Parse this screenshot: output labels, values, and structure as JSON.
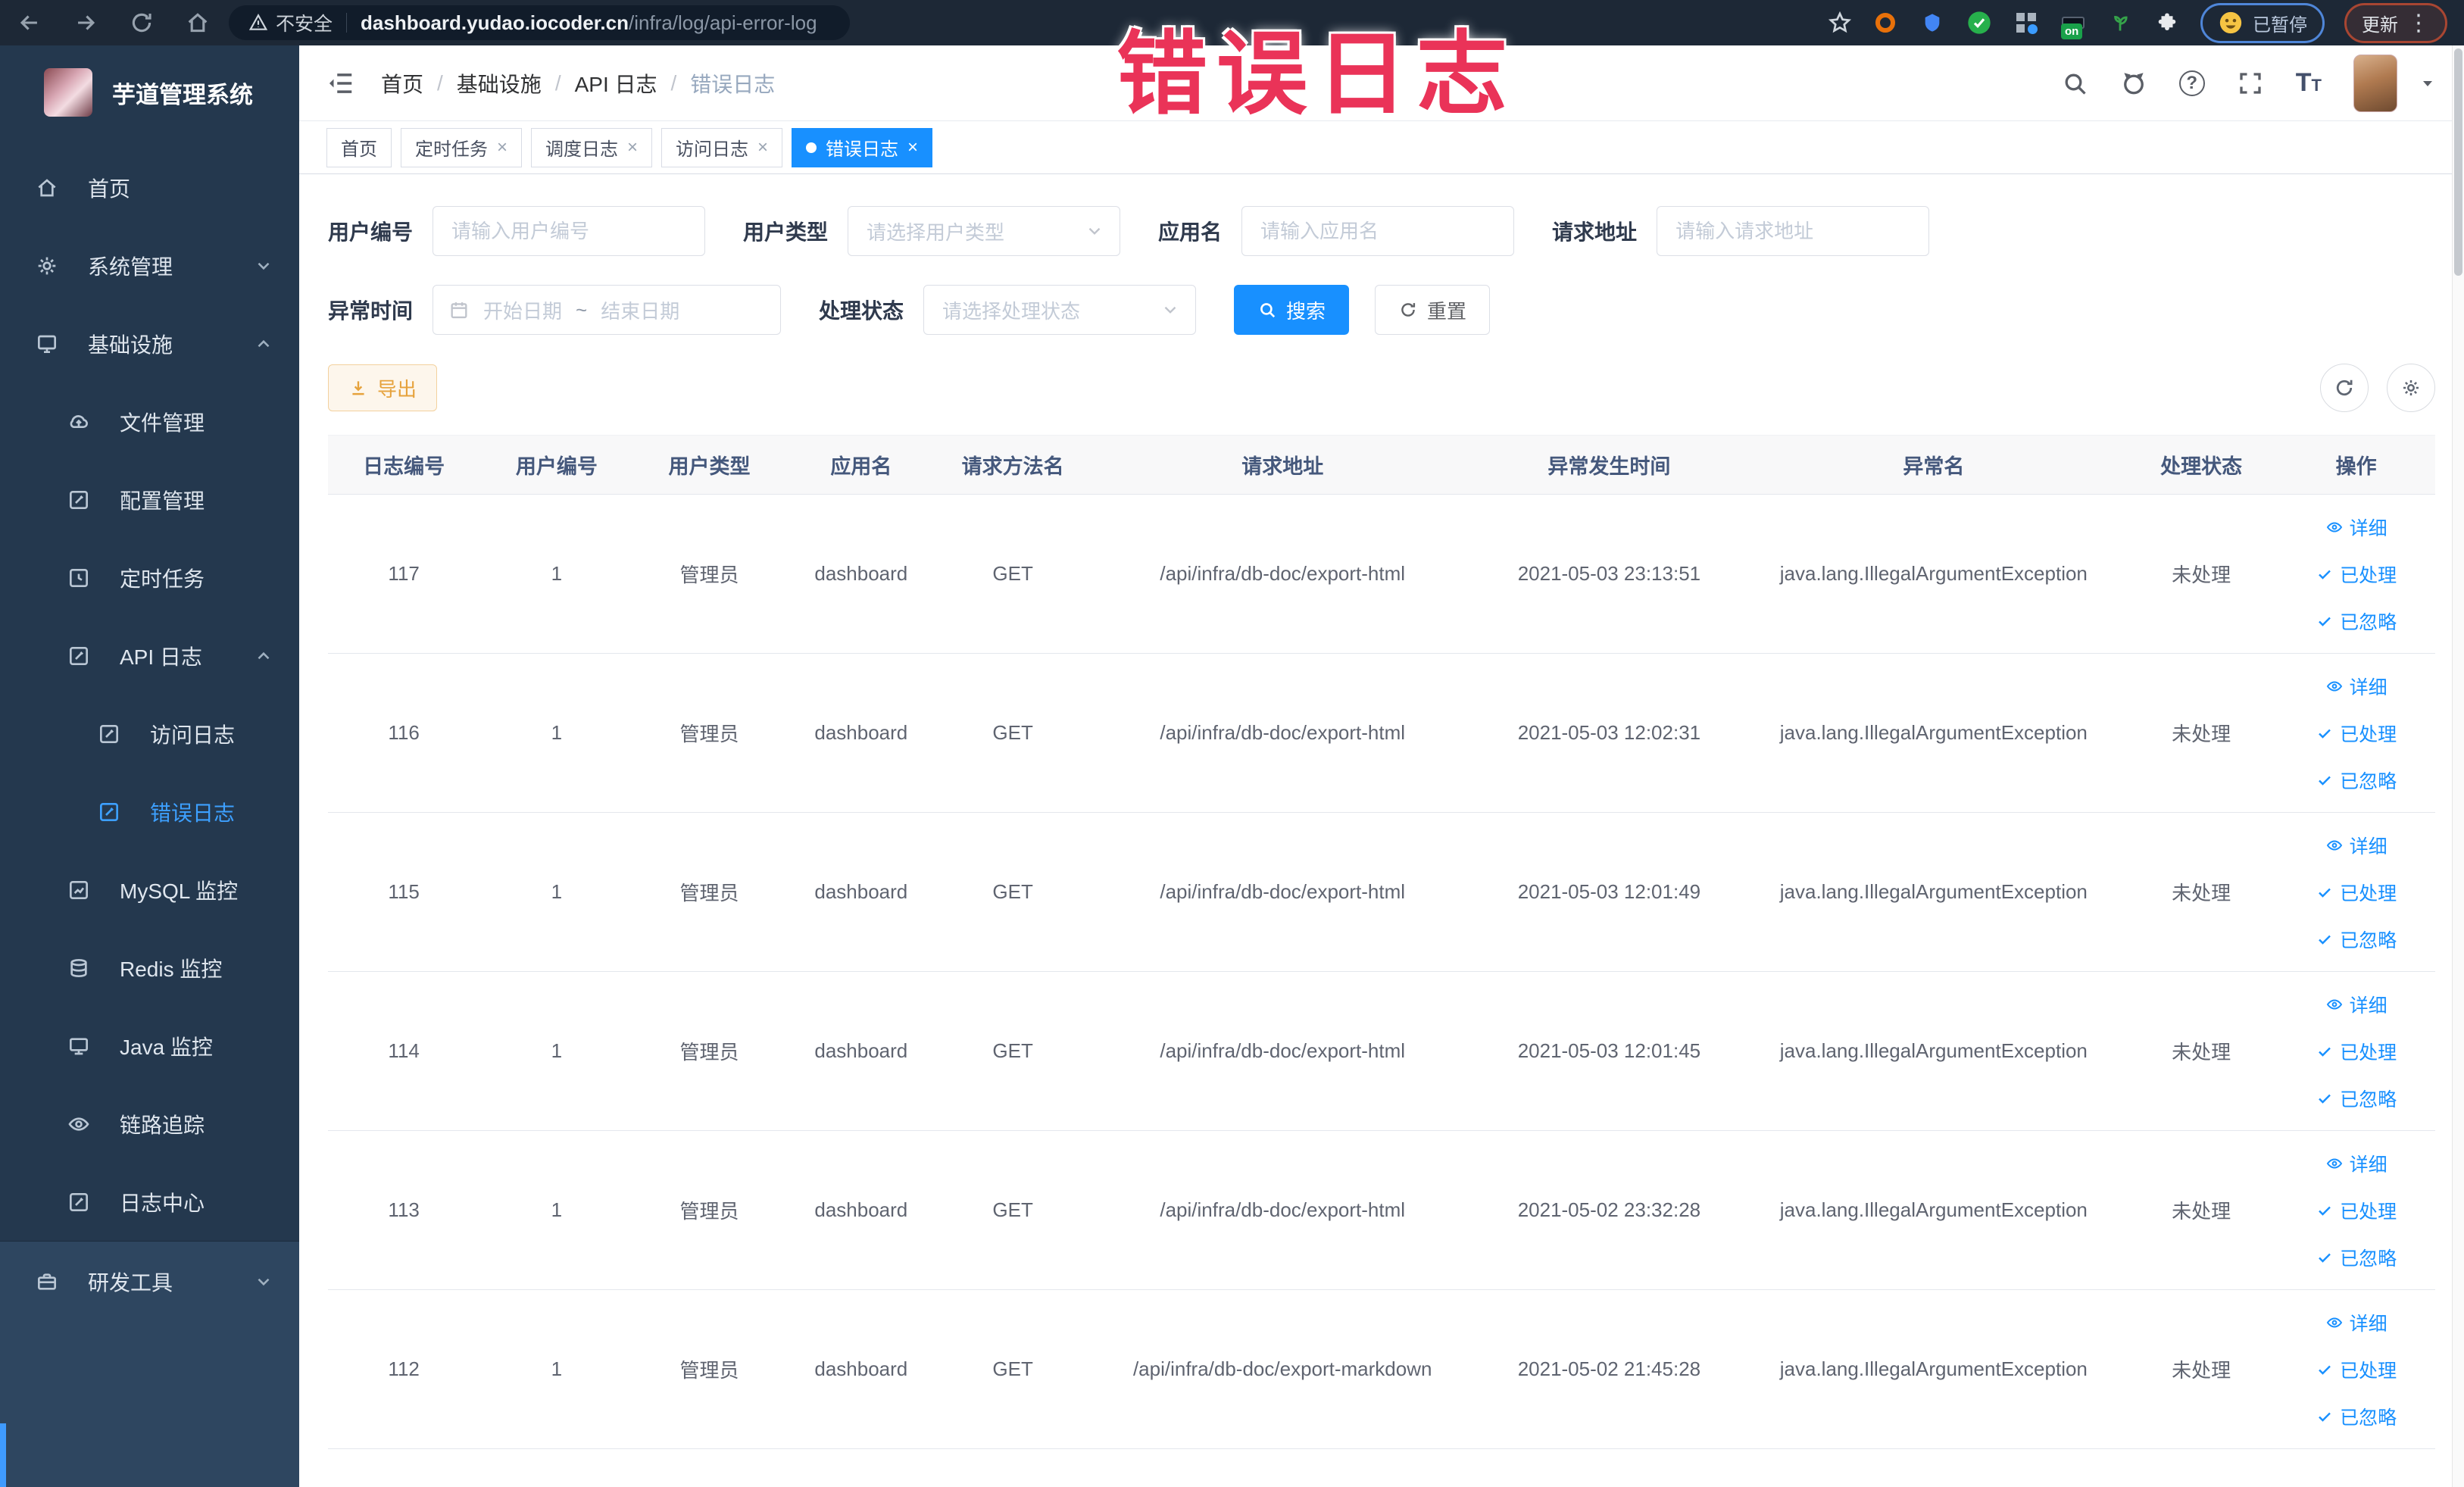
{
  "browser": {
    "security_label": "不安全",
    "url_host": "dashboard.yudao.iocoder.cn",
    "url_path": "/infra/log/api-error-log",
    "extension_on_badge": "on",
    "paused_badge": "已暂停",
    "update_button": "更新"
  },
  "overlay": {
    "title": "错误日志"
  },
  "sidebar": {
    "title": "芋道管理系统",
    "items": [
      {
        "label": "首页"
      },
      {
        "label": "系统管理"
      },
      {
        "label": "基础设施"
      },
      {
        "label": "文件管理"
      },
      {
        "label": "配置管理"
      },
      {
        "label": "定时任务"
      },
      {
        "label": "API 日志"
      },
      {
        "label": "访问日志"
      },
      {
        "label": "错误日志"
      },
      {
        "label": "MySQL 监控"
      },
      {
        "label": "Redis 监控"
      },
      {
        "label": "Java 监控"
      },
      {
        "label": "链路追踪"
      },
      {
        "label": "日志中心"
      },
      {
        "label": "研发工具"
      }
    ]
  },
  "header": {
    "breadcrumb": [
      "首页",
      "基础设施",
      "API 日志",
      "错误日志"
    ]
  },
  "tabs": [
    {
      "label": "首页"
    },
    {
      "label": "定时任务"
    },
    {
      "label": "调度日志"
    },
    {
      "label": "访问日志"
    },
    {
      "label": "错误日志"
    }
  ],
  "filters": {
    "user_id": {
      "label": "用户编号",
      "placeholder": "请输入用户编号"
    },
    "user_type": {
      "label": "用户类型",
      "placeholder": "请选择用户类型"
    },
    "app_name": {
      "label": "应用名",
      "placeholder": "请输入应用名"
    },
    "request_url": {
      "label": "请求地址",
      "placeholder": "请输入请求地址"
    },
    "exception_time": {
      "label": "异常时间",
      "start_placeholder": "开始日期",
      "separator": "~",
      "end_placeholder": "结束日期"
    },
    "process_status": {
      "label": "处理状态",
      "placeholder": "请选择处理状态"
    },
    "search_button": "搜索",
    "reset_button": "重置"
  },
  "toolbar": {
    "export_button": "导出"
  },
  "table": {
    "columns": [
      "日志编号",
      "用户编号",
      "用户类型",
      "应用名",
      "请求方法名",
      "请求地址",
      "异常发生时间",
      "异常名",
      "处理状态",
      "操作"
    ],
    "actions": [
      "详细",
      "已处理",
      "已忽略"
    ],
    "rows": [
      {
        "id": "117",
        "user_id": "1",
        "user_type": "管理员",
        "app": "dashboard",
        "method": "GET",
        "url": "/api/infra/db-doc/export-html",
        "time": "2021-05-03 23:13:51",
        "exception": "java.lang.IllegalArgumentException",
        "status": "未处理"
      },
      {
        "id": "116",
        "user_id": "1",
        "user_type": "管理员",
        "app": "dashboard",
        "method": "GET",
        "url": "/api/infra/db-doc/export-html",
        "time": "2021-05-03 12:02:31",
        "exception": "java.lang.IllegalArgumentException",
        "status": "未处理"
      },
      {
        "id": "115",
        "user_id": "1",
        "user_type": "管理员",
        "app": "dashboard",
        "method": "GET",
        "url": "/api/infra/db-doc/export-html",
        "time": "2021-05-03 12:01:49",
        "exception": "java.lang.IllegalArgumentException",
        "status": "未处理"
      },
      {
        "id": "114",
        "user_id": "1",
        "user_type": "管理员",
        "app": "dashboard",
        "method": "GET",
        "url": "/api/infra/db-doc/export-html",
        "time": "2021-05-03 12:01:45",
        "exception": "java.lang.IllegalArgumentException",
        "status": "未处理"
      },
      {
        "id": "113",
        "user_id": "1",
        "user_type": "管理员",
        "app": "dashboard",
        "method": "GET",
        "url": "/api/infra/db-doc/export-html",
        "time": "2021-05-02 23:32:28",
        "exception": "java.lang.IllegalArgumentException",
        "status": "未处理"
      },
      {
        "id": "112",
        "user_id": "1",
        "user_type": "管理员",
        "app": "dashboard",
        "method": "GET",
        "url": "/api/infra/db-doc/export-markdown",
        "time": "2021-05-02 21:45:28",
        "exception": "java.lang.IllegalArgumentException",
        "status": "未处理"
      }
    ]
  },
  "colors": {
    "accent": "#1890ff",
    "sidebar_bg": "#24384e",
    "warning": "#e6a23c",
    "annotation": "#ea3358"
  }
}
